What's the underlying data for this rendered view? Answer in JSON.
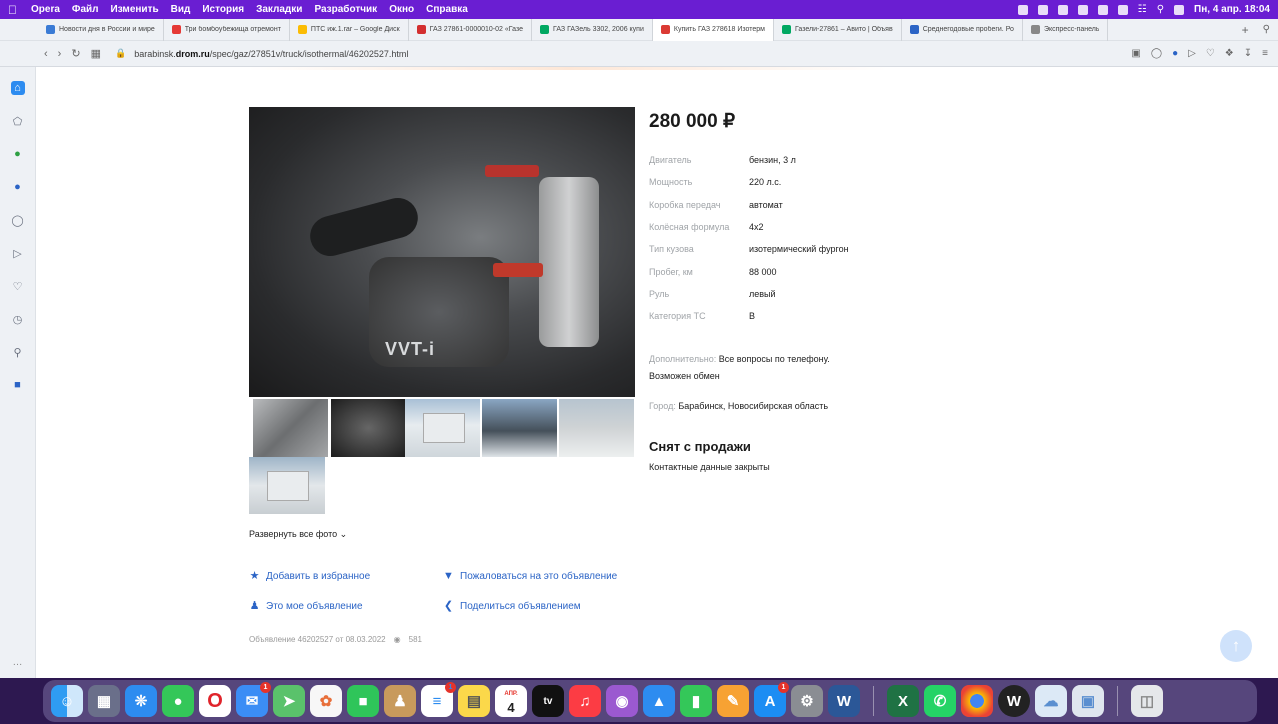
{
  "menubar": {
    "app": "Opera",
    "items": [
      "Файл",
      "Изменить",
      "Вид",
      "История",
      "Закладки",
      "Разработчик",
      "Окно",
      "Справка"
    ],
    "clock": "Пн, 4 апр.  18:04"
  },
  "tabs": [
    {
      "title": "Новости дня в России и мире",
      "color": "#3a7bd5"
    },
    {
      "title": "Три бомбоубежища отремонт",
      "color": "#e53935"
    },
    {
      "title": "ПТС иж.1.rar – Google Диск",
      "color": "#fbbc04"
    },
    {
      "title": "ГАЗ 27861-0000010-02 «Газе",
      "color": "#d32f2f"
    },
    {
      "title": "ГАЗ ГАЗель 3302, 2006 купи",
      "color": "#00a862"
    },
    {
      "title": "Купить ГАЗ 278618 Изотерм",
      "color": "#db3a34",
      "active": true
    },
    {
      "title": "Газели-27861 – Авито | Объяв",
      "color": "#00a862"
    },
    {
      "title": "Среднегодовые пробеги. Ро",
      "color": "#2b64c6"
    },
    {
      "title": "Экспресс-панель",
      "color": "#888888"
    }
  ],
  "address": {
    "prefix": "barabinsk.",
    "domain": "drom.ru",
    "path": "/spec/gaz/27851v/truck/isothermal/46202527.html"
  },
  "listing": {
    "price": "280 000 ₽",
    "specs": [
      {
        "k": "Двигатель",
        "v": "бензин, 3 л"
      },
      {
        "k": "Мощность",
        "v": "220 л.с."
      },
      {
        "k": "Коробка передач",
        "v": "автомат"
      },
      {
        "k": "Колёсная формула",
        "v": "4x2"
      },
      {
        "k": "Тип кузова",
        "v": "изотермический фургон"
      },
      {
        "k": "Пробег, км",
        "v": "88 000"
      },
      {
        "k": "Руль",
        "v": "левый"
      },
      {
        "k": "Категория ТС",
        "v": "B"
      }
    ],
    "extra_label": "Дополнительно:",
    "extra_value": "Все вопросы по телефону.",
    "extra_value2": "Возможен обмен",
    "city_label": "Город:",
    "city_value": "Барабинск, Новосибирская область",
    "status": "Снят с продажи",
    "contacts": "Контактные данные закрыты",
    "photo_text": "VVT-i",
    "expand_photos": "Развернуть все фото",
    "actions": {
      "favorite": "Добавить в избранное",
      "complain": "Пожаловаться на это объявление",
      "mine": "Это мое объявление",
      "share": "Поделиться объявлением"
    },
    "meta_id": "Объявление 46202527 от 08.03.2022",
    "views": "581"
  },
  "dock": {
    "calendar_month": "АПР.",
    "calendar_day": "4",
    "badges": {
      "mail": "1",
      "reminders": "1",
      "appstore": "1"
    }
  }
}
